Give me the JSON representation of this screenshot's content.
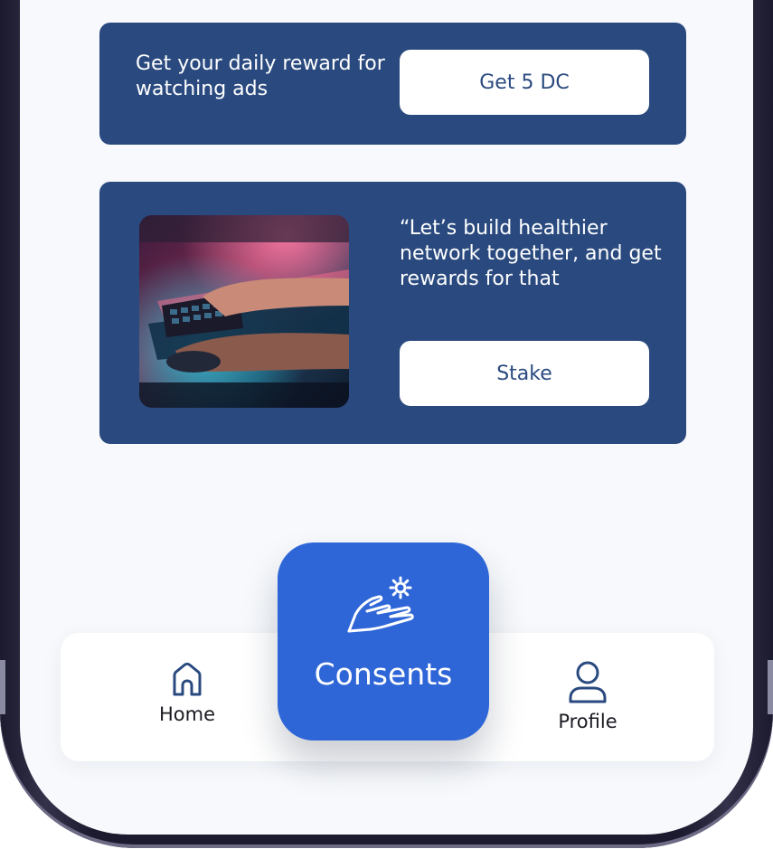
{
  "reward_card": {
    "text": "Get your daily reward for watching ads",
    "button_label": "Get 5 DC"
  },
  "stake_card": {
    "quote": "“Let’s build healthier network together, and get rewards for that",
    "button_label": "Stake",
    "image_icon": "gaming-keyboard-photo"
  },
  "nav": {
    "home_label": "Home",
    "consents_label": "Consents",
    "profile_label": "Profile",
    "home_icon": "home-icon",
    "consents_icon": "hand-gear-icon",
    "profile_icon": "user-icon"
  },
  "colors": {
    "card_bg": "#2a4a7f",
    "accent": "#2f66d7",
    "screen_bg": "#f7f9fc"
  }
}
